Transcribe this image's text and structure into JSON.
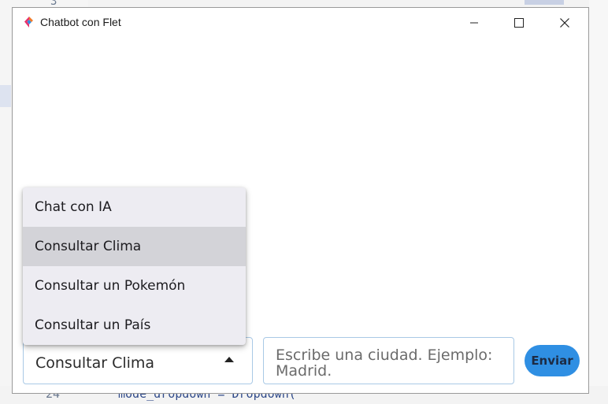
{
  "background_editor": {
    "top_line_number": "3",
    "bottom_line_number": "24",
    "bottom_code": "mode_dropdown = Dropdown("
  },
  "window": {
    "title": "Chatbot con Flet",
    "icon": "flet-logo-icon",
    "controls": [
      "minimize-icon",
      "maximize-icon",
      "close-icon"
    ]
  },
  "mode_dropdown": {
    "selected_value": "Consultar Clima",
    "options": [
      {
        "label": "Chat con IA",
        "selected": false
      },
      {
        "label": "Consultar Clima",
        "selected": true
      },
      {
        "label": "Consultar un Pokemón",
        "selected": false
      },
      {
        "label": "Consultar un País",
        "selected": false
      }
    ]
  },
  "message_input": {
    "value": "",
    "placeholder": "Escribe una ciudad. Ejemplo: Madrid."
  },
  "send_button": {
    "label": "Enviar",
    "color": "#2f8fe3"
  }
}
